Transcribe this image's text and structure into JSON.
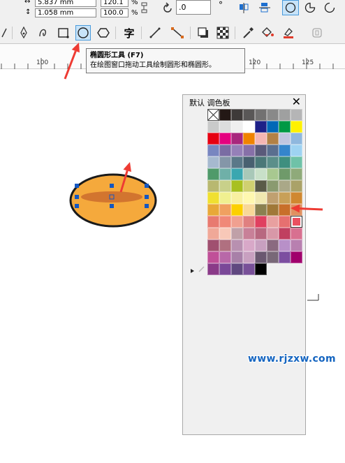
{
  "property_bar": {
    "width_value": "5.837 mm",
    "height_value": "1.058 mm",
    "scale_x": "120.1",
    "scale_y": "100.0",
    "percent_symbol": "%",
    "angle_value": ".0",
    "degree_symbol": "°"
  },
  "toolbox": {
    "tools": [
      {
        "name": "pen-tool-icon"
      },
      {
        "name": "bspline-tool-icon"
      },
      {
        "name": "rectangle-tool-icon"
      },
      {
        "name": "ellipse-tool-icon",
        "active": true
      },
      {
        "name": "polygon-tool-icon"
      },
      {
        "name": "text-tool-icon",
        "glyph": "字"
      },
      {
        "name": "dimension-tool-icon"
      },
      {
        "name": "connector-tool-icon"
      },
      {
        "name": "drop-shadow-tool-icon"
      },
      {
        "name": "transparency-tool-icon"
      },
      {
        "name": "eyedropper-tool-icon"
      },
      {
        "name": "interactive-fill-tool-icon"
      },
      {
        "name": "smart-fill-tool-icon"
      },
      {
        "name": "lock-icon"
      }
    ]
  },
  "ruler": {
    "labels": [
      "100",
      "105",
      "110",
      "115",
      "120",
      "125"
    ]
  },
  "tooltip": {
    "title": "椭圆形工具 (F7)",
    "description": "在绘图窗口拖动工具绘制圆形和椭圆形。"
  },
  "canvas": {
    "ellipse_fill": "#f5a93c",
    "ellipse_stroke": "#1a1a1a",
    "inner_ellipse_fill": "#d2752f",
    "handle_color": "#1557c0",
    "arrow_color": "#ee3b33"
  },
  "palette_docker": {
    "title": "默认 调色板",
    "close_label": "✕",
    "swatches": [
      "none",
      "#231815",
      "#3e3a39",
      "#595757",
      "#727171",
      "#898989",
      "#9fa0a0",
      "#b5b5b6",
      "#c9caca",
      "#dcdddd",
      "#efefef",
      "#ffffff",
      "#1d2088",
      "#0068b7",
      "#009944",
      "#fff100",
      "#e60012",
      "#e4007f",
      "#a8277d",
      "#f08300",
      "#f4b6b4",
      "#b28146",
      "#c0c5e0",
      "#8fb8de",
      "#7886c0",
      "#7a6ca3",
      "#9580b8",
      "#8770a8",
      "#5a5a7a",
      "#5a6f8f",
      "#3585cc",
      "#9ed3f2",
      "#a6b9cf",
      "#8496a8",
      "#5a7888",
      "#486070",
      "#4a7878",
      "#5b8f8a",
      "#3f8f7f",
      "#6fc2a8",
      "#4f9a6a",
      "#6fb0a8",
      "#3aa7b0",
      "#a8c8b8",
      "#c8e0c8",
      "#a8c890",
      "#6f9a6a",
      "#8faa7a",
      "#b8b870",
      "#c8d08a",
      "#a8c020",
      "#d0d070",
      "#5a5a48",
      "#8a9a70",
      "#aaa888",
      "#aaa268",
      "#f0e030",
      "#f0f090",
      "#f8f0a0",
      "#fff8b0",
      "#f0e8b0",
      "#c0a070",
      "#c8a058",
      "#d08830",
      "#e8a838",
      "#f0a060",
      "#fcd000",
      "#f8d898",
      "#8a8050",
      "#a07838",
      "#c86f2a",
      "#e09060",
      "#e87a70",
      "#f08878",
      "#f0a090",
      "#e08080",
      "#e04060",
      "#e8a0a0",
      "#e67070",
      "#ea5060",
      "#f0a898",
      "#f8c8b8",
      "#c0a0a8",
      "#c88098",
      "#b86880",
      "#d898a8",
      "#c04060",
      "#d87090",
      "#a05070",
      "#b07080",
      "#b890b0",
      "#d8a8c8",
      "#c8a0c0",
      "#8a6a80",
      "#b890c8",
      "#b880b0",
      "#c05098",
      "#b868a8",
      "#a880a8",
      "#c8a0c0",
      "#6a5870",
      "#786878",
      "#7c4ea0",
      "#a0006c",
      "#8a3a88",
      "#7a4898",
      "#604880",
      "#785098",
      "#000000"
    ],
    "selected_index": 79
  },
  "watermark": "www.rjzxw.com"
}
